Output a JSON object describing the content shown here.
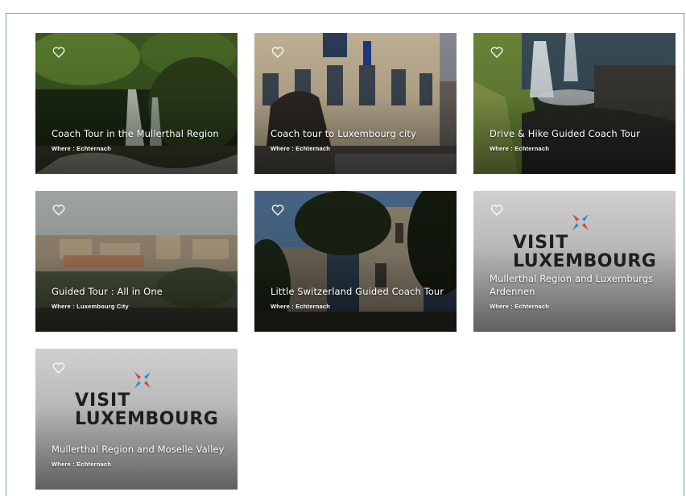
{
  "cards": [
    {
      "title": "Coach Tour in the Mullerthal Region",
      "where": "Where : Echternach",
      "image": "waterfall-forest"
    },
    {
      "title": "Coach tour to Luxembourg city",
      "where": "Where : Echternach",
      "image": "city-hall-lion"
    },
    {
      "title": "Drive & Hike Guided Coach Tour",
      "where": "Where : Echternach",
      "image": "mossy-waterfall"
    },
    {
      "title": "Guided Tour : All in One",
      "where": "Where : Luxembourg City",
      "image": "luxembourg-panorama"
    },
    {
      "title": "Little Switzerland Guided Coach Tour",
      "where": "Where : Echternach",
      "image": "castle-trees"
    },
    {
      "title": "Mullerthal Region and Luxemburgs Ardennen",
      "where": "Where : Echternach",
      "image": "visit-luxembourg-logo",
      "logo": {
        "line1": "VISIT",
        "line2": "LUXEMBOURG"
      }
    },
    {
      "title": "Mullerthal Region and Moselle Valley",
      "where": "Where : Echternach",
      "image": "visit-luxembourg-logo",
      "logo": {
        "line1": "VISIT",
        "line2": "LUXEMBOURG"
      }
    }
  ],
  "colors": {
    "frame_border": "#7a9cc6",
    "logo_red": "#e23a3f",
    "logo_blue": "#2a8fd1"
  }
}
